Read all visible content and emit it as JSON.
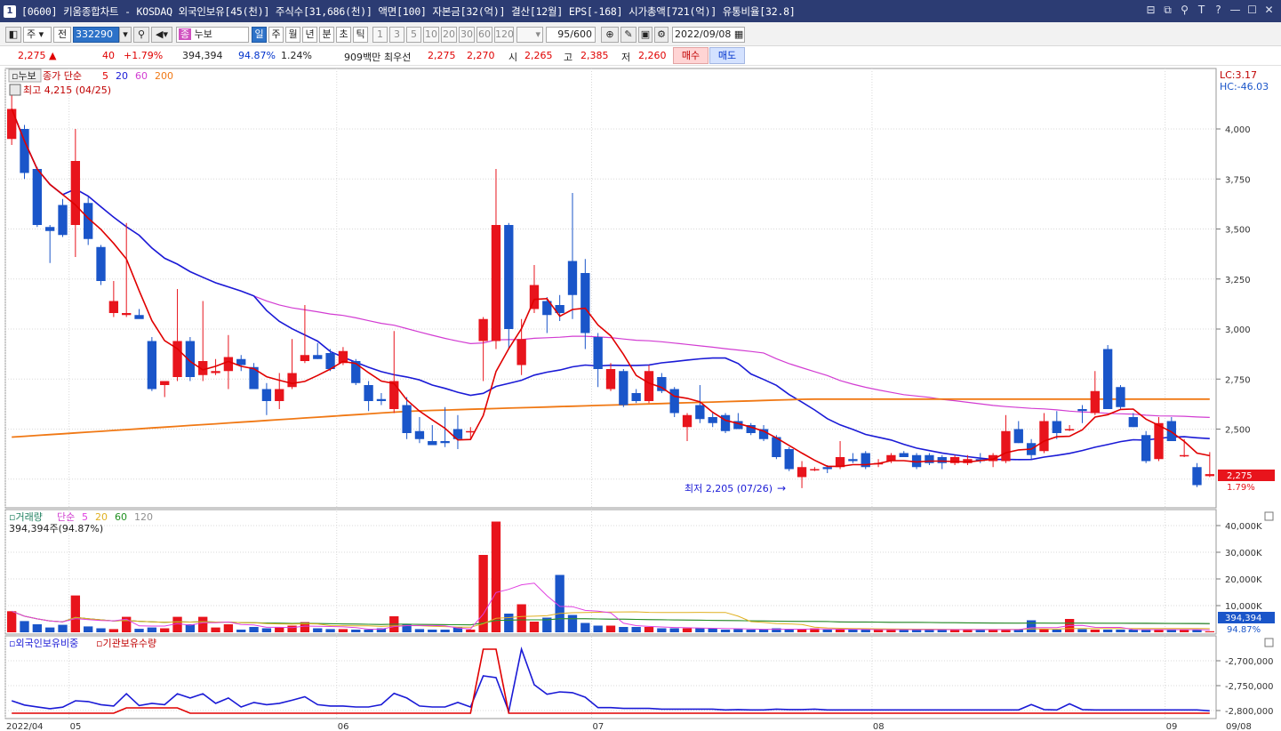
{
  "window": {
    "num": "1",
    "title": "[0600] 키움종합차트 - KOSDAQ 외국인보유[45(천)] 주식수[31,686(천)] 액면[100] 자본금[32(억)] 결산[12월] EPS[-168] 시가총액[721(억)] 유통비율[32.8]"
  },
  "toolbar": {
    "code_prefix": "주",
    "code_sel": "전",
    "code_value": "332290",
    "mode_label": "누보",
    "periods": [
      "일",
      "주",
      "월",
      "년",
      "분",
      "초",
      "틱"
    ],
    "active_period": "일",
    "minute_opts": [
      "1",
      "3",
      "5",
      "10",
      "20",
      "30",
      "60",
      "120"
    ],
    "count": "95/600",
    "date": "2022/09/08"
  },
  "quote": {
    "price": "2,275",
    "change": "40",
    "change_pct": "+1.79%",
    "volume": "394,394",
    "vol_ratio": "94.87%",
    "turnover": "1.24%",
    "amount": "909백만",
    "best_label": "최우선",
    "ask": "2,275",
    "bid": "2,270",
    "open_label": "시",
    "open": "2,265",
    "high_label": "고",
    "high": "2,385",
    "low_label": "저",
    "low": "2,260",
    "buy_label": "매수",
    "sell_label": "매도"
  },
  "price_panel": {
    "name": "누보",
    "legend_label": "종가 단순",
    "ma_periods": [
      "5",
      "20",
      "60",
      "200"
    ],
    "high_note": "최고 4,215 (04/25)",
    "low_note": "최저 2,205 (07/26)",
    "lc_label": "LC:3.17",
    "hc_label": "HC:-46.03",
    "current_price": "2,275",
    "current_pct": "1.79%",
    "y_ticks": [
      "4,000",
      "3,750",
      "3,500",
      "3,250",
      "3,000",
      "2,750",
      "2,500"
    ]
  },
  "volume_panel": {
    "name": "거래량",
    "legend_label": "단순",
    "ma_periods": [
      "5",
      "20",
      "60",
      "120"
    ],
    "current_note": "394,394주(94.87%)",
    "current_value": "394,394",
    "current_pct": "94.87%",
    "y_ticks": [
      "40,000K",
      "30,000K",
      "20,000K",
      "10,000K"
    ]
  },
  "investor_panel": {
    "label_foreign": "외국인보유비중",
    "label_inst": "기관보유수량",
    "y_ticks": [
      "-2,700,000",
      "-2,750,000",
      "-2,800,000"
    ]
  },
  "x_axis": {
    "labels": [
      "2022/04",
      "05",
      "06",
      "07",
      "08",
      "09",
      "09/08"
    ]
  },
  "colors": {
    "up": "#e8141c",
    "down": "#1a55c9",
    "ma5": "#e00000",
    "ma20": "#1a1ad6",
    "ma60": "#d23cd2",
    "ma200": "#f07814",
    "vol_ma5": "#e040e0",
    "vol_ma20": "#e0b020",
    "vol_ma60": "#209020",
    "vol_ma120": "#909090",
    "title_bg": "#2c3c73"
  },
  "chart_data": {
    "type": "candlestick",
    "candles": [
      {
        "o": 3950,
        "h": 4215,
        "l": 3920,
        "c": 4100
      },
      {
        "o": 4000,
        "h": 4020,
        "l": 3750,
        "c": 3780
      },
      {
        "o": 3800,
        "h": 3810,
        "l": 3510,
        "c": 3520
      },
      {
        "o": 3510,
        "h": 3520,
        "l": 3330,
        "c": 3490
      },
      {
        "o": 3620,
        "h": 3650,
        "l": 3460,
        "c": 3470
      },
      {
        "o": 3520,
        "h": 4000,
        "l": 3360,
        "c": 3840
      },
      {
        "o": 3630,
        "h": 3660,
        "l": 3420,
        "c": 3450
      },
      {
        "o": 3410,
        "h": 3420,
        "l": 3220,
        "c": 3240
      },
      {
        "o": 3080,
        "h": 3240,
        "l": 3060,
        "c": 3140
      },
      {
        "o": 3070,
        "h": 3530,
        "l": 3060,
        "c": 3080
      },
      {
        "o": 3070,
        "h": 3100,
        "l": 3060,
        "c": 3050
      },
      {
        "o": 2940,
        "h": 2960,
        "l": 2690,
        "c": 2700
      },
      {
        "o": 2720,
        "h": 2740,
        "l": 2660,
        "c": 2740
      },
      {
        "o": 2760,
        "h": 3200,
        "l": 2740,
        "c": 2940
      },
      {
        "o": 2940,
        "h": 2960,
        "l": 2740,
        "c": 2760
      },
      {
        "o": 2770,
        "h": 3140,
        "l": 2740,
        "c": 2840
      },
      {
        "o": 2780,
        "h": 2850,
        "l": 2770,
        "c": 2790
      },
      {
        "o": 2790,
        "h": 2970,
        "l": 2700,
        "c": 2860
      },
      {
        "o": 2850,
        "h": 2870,
        "l": 2790,
        "c": 2820
      },
      {
        "o": 2810,
        "h": 2830,
        "l": 2700,
        "c": 2700
      },
      {
        "o": 2700,
        "h": 2730,
        "l": 2570,
        "c": 2640
      },
      {
        "o": 2640,
        "h": 2780,
        "l": 2600,
        "c": 2700
      },
      {
        "o": 2710,
        "h": 2950,
        "l": 2700,
        "c": 2780
      },
      {
        "o": 2840,
        "h": 3120,
        "l": 2830,
        "c": 2870
      },
      {
        "o": 2870,
        "h": 2930,
        "l": 2850,
        "c": 2850
      },
      {
        "o": 2880,
        "h": 2900,
        "l": 2790,
        "c": 2800
      },
      {
        "o": 2830,
        "h": 2910,
        "l": 2820,
        "c": 2890
      },
      {
        "o": 2840,
        "h": 2850,
        "l": 2720,
        "c": 2730
      },
      {
        "o": 2720,
        "h": 2740,
        "l": 2590,
        "c": 2640
      },
      {
        "o": 2650,
        "h": 2680,
        "l": 2620,
        "c": 2640
      },
      {
        "o": 2600,
        "h": 2990,
        "l": 2580,
        "c": 2740
      },
      {
        "o": 2620,
        "h": 2660,
        "l": 2450,
        "c": 2480
      },
      {
        "o": 2490,
        "h": 2560,
        "l": 2430,
        "c": 2450
      },
      {
        "o": 2440,
        "h": 2520,
        "l": 2420,
        "c": 2420
      },
      {
        "o": 2440,
        "h": 2610,
        "l": 2410,
        "c": 2430
      },
      {
        "o": 2500,
        "h": 2570,
        "l": 2400,
        "c": 2450
      },
      {
        "o": 2490,
        "h": 2510,
        "l": 2450,
        "c": 2490
      },
      {
        "o": 2940,
        "h": 3060,
        "l": 2740,
        "c": 3050
      },
      {
        "o": 2940,
        "h": 3800,
        "l": 2900,
        "c": 3520
      },
      {
        "o": 3520,
        "h": 3530,
        "l": 2900,
        "c": 3000
      },
      {
        "o": 2820,
        "h": 3050,
        "l": 2770,
        "c": 2950
      },
      {
        "o": 3100,
        "h": 3320,
        "l": 3080,
        "c": 3220
      },
      {
        "o": 3140,
        "h": 3160,
        "l": 2980,
        "c": 3070
      },
      {
        "o": 3120,
        "h": 3170,
        "l": 3040,
        "c": 3080
      },
      {
        "o": 3340,
        "h": 3680,
        "l": 3050,
        "c": 3170
      },
      {
        "o": 3280,
        "h": 3350,
        "l": 2900,
        "c": 2980
      },
      {
        "o": 2960,
        "h": 2980,
        "l": 2710,
        "c": 2800
      },
      {
        "o": 2700,
        "h": 2830,
        "l": 2690,
        "c": 2800
      },
      {
        "o": 2790,
        "h": 2800,
        "l": 2610,
        "c": 2620
      },
      {
        "o": 2680,
        "h": 2700,
        "l": 2630,
        "c": 2640
      },
      {
        "o": 2640,
        "h": 2820,
        "l": 2630,
        "c": 2790
      },
      {
        "o": 2760,
        "h": 2780,
        "l": 2680,
        "c": 2690
      },
      {
        "o": 2700,
        "h": 2710,
        "l": 2560,
        "c": 2580
      },
      {
        "o": 2510,
        "h": 2580,
        "l": 2440,
        "c": 2570
      },
      {
        "o": 2620,
        "h": 2720,
        "l": 2530,
        "c": 2550
      },
      {
        "o": 2560,
        "h": 2580,
        "l": 2510,
        "c": 2530
      },
      {
        "o": 2570,
        "h": 2580,
        "l": 2480,
        "c": 2490
      },
      {
        "o": 2540,
        "h": 2580,
        "l": 2500,
        "c": 2500
      },
      {
        "o": 2520,
        "h": 2530,
        "l": 2470,
        "c": 2480
      },
      {
        "o": 2500,
        "h": 2520,
        "l": 2440,
        "c": 2450
      },
      {
        "o": 2460,
        "h": 2470,
        "l": 2350,
        "c": 2360
      },
      {
        "o": 2400,
        "h": 2410,
        "l": 2290,
        "c": 2300
      },
      {
        "o": 2260,
        "h": 2340,
        "l": 2205,
        "c": 2310
      },
      {
        "o": 2300,
        "h": 2310,
        "l": 2290,
        "c": 2300
      },
      {
        "o": 2310,
        "h": 2320,
        "l": 2280,
        "c": 2300
      },
      {
        "o": 2310,
        "h": 2440,
        "l": 2300,
        "c": 2360
      },
      {
        "o": 2350,
        "h": 2380,
        "l": 2330,
        "c": 2340
      },
      {
        "o": 2380,
        "h": 2390,
        "l": 2300,
        "c": 2310
      },
      {
        "o": 2330,
        "h": 2350,
        "l": 2310,
        "c": 2330
      },
      {
        "o": 2340,
        "h": 2380,
        "l": 2330,
        "c": 2370
      },
      {
        "o": 2380,
        "h": 2390,
        "l": 2360,
        "c": 2360
      },
      {
        "o": 2370,
        "h": 2380,
        "l": 2300,
        "c": 2310
      },
      {
        "o": 2370,
        "h": 2380,
        "l": 2320,
        "c": 2330
      },
      {
        "o": 2360,
        "h": 2370,
        "l": 2300,
        "c": 2330
      },
      {
        "o": 2330,
        "h": 2370,
        "l": 2320,
        "c": 2360
      },
      {
        "o": 2330,
        "h": 2370,
        "l": 2320,
        "c": 2350
      },
      {
        "o": 2350,
        "h": 2380,
        "l": 2330,
        "c": 2340
      },
      {
        "o": 2340,
        "h": 2380,
        "l": 2310,
        "c": 2370
      },
      {
        "o": 2340,
        "h": 2570,
        "l": 2330,
        "c": 2490
      },
      {
        "o": 2500,
        "h": 2540,
        "l": 2430,
        "c": 2430
      },
      {
        "o": 2430,
        "h": 2450,
        "l": 2350,
        "c": 2370
      },
      {
        "o": 2390,
        "h": 2580,
        "l": 2380,
        "c": 2540
      },
      {
        "o": 2540,
        "h": 2590,
        "l": 2450,
        "c": 2480
      },
      {
        "o": 2500,
        "h": 2520,
        "l": 2490,
        "c": 2500
      },
      {
        "o": 2600,
        "h": 2620,
        "l": 2530,
        "c": 2590
      },
      {
        "o": 2580,
        "h": 2790,
        "l": 2570,
        "c": 2690
      },
      {
        "o": 2900,
        "h": 2920,
        "l": 2600,
        "c": 2600
      },
      {
        "o": 2710,
        "h": 2720,
        "l": 2600,
        "c": 2610
      },
      {
        "o": 2560,
        "h": 2580,
        "l": 2510,
        "c": 2510
      },
      {
        "o": 2470,
        "h": 2490,
        "l": 2330,
        "c": 2340
      },
      {
        "o": 2350,
        "h": 2560,
        "l": 2340,
        "c": 2530
      },
      {
        "o": 2540,
        "h": 2560,
        "l": 2440,
        "c": 2440
      },
      {
        "o": 2370,
        "h": 2450,
        "l": 2360,
        "c": 2370
      },
      {
        "o": 2310,
        "h": 2330,
        "l": 2210,
        "c": 2220
      },
      {
        "o": 2265,
        "h": 2385,
        "l": 2260,
        "c": 2275
      }
    ],
    "ma200_line": [
      2460,
      2590,
      2650,
      2650
    ],
    "volume_k": [
      7900,
      4200,
      3000,
      1800,
      2800,
      13800,
      2200,
      1500,
      1200,
      5800,
      1300,
      1800,
      1500,
      5800,
      3000,
      5800,
      1800,
      3000,
      1000,
      2000,
      1500,
      1800,
      2500,
      3800,
      1500,
      1200,
      1200,
      1000,
      1000,
      1500,
      6000,
      3000,
      1200,
      1000,
      1000,
      2000,
      1000,
      29000,
      41500,
      7000,
      10500,
      4000,
      5500,
      21500,
      6500,
      3500,
      2500,
      2500,
      2000,
      2000,
      2000,
      1500,
      1500,
      1500,
      1500,
      1500,
      1000,
      1200,
      1000,
      1000,
      1500,
      1200,
      1200,
      1500,
      1000,
      1000,
      1000,
      1000,
      1000,
      1000,
      1000,
      1000,
      1000,
      1000,
      1000,
      1000,
      1000,
      1000,
      1000,
      1000,
      4500,
      1200,
      1000,
      5000,
      1200,
      1000,
      1000,
      1000,
      1000,
      1000,
      1000,
      1000,
      1000,
      1000,
      394
    ]
  }
}
